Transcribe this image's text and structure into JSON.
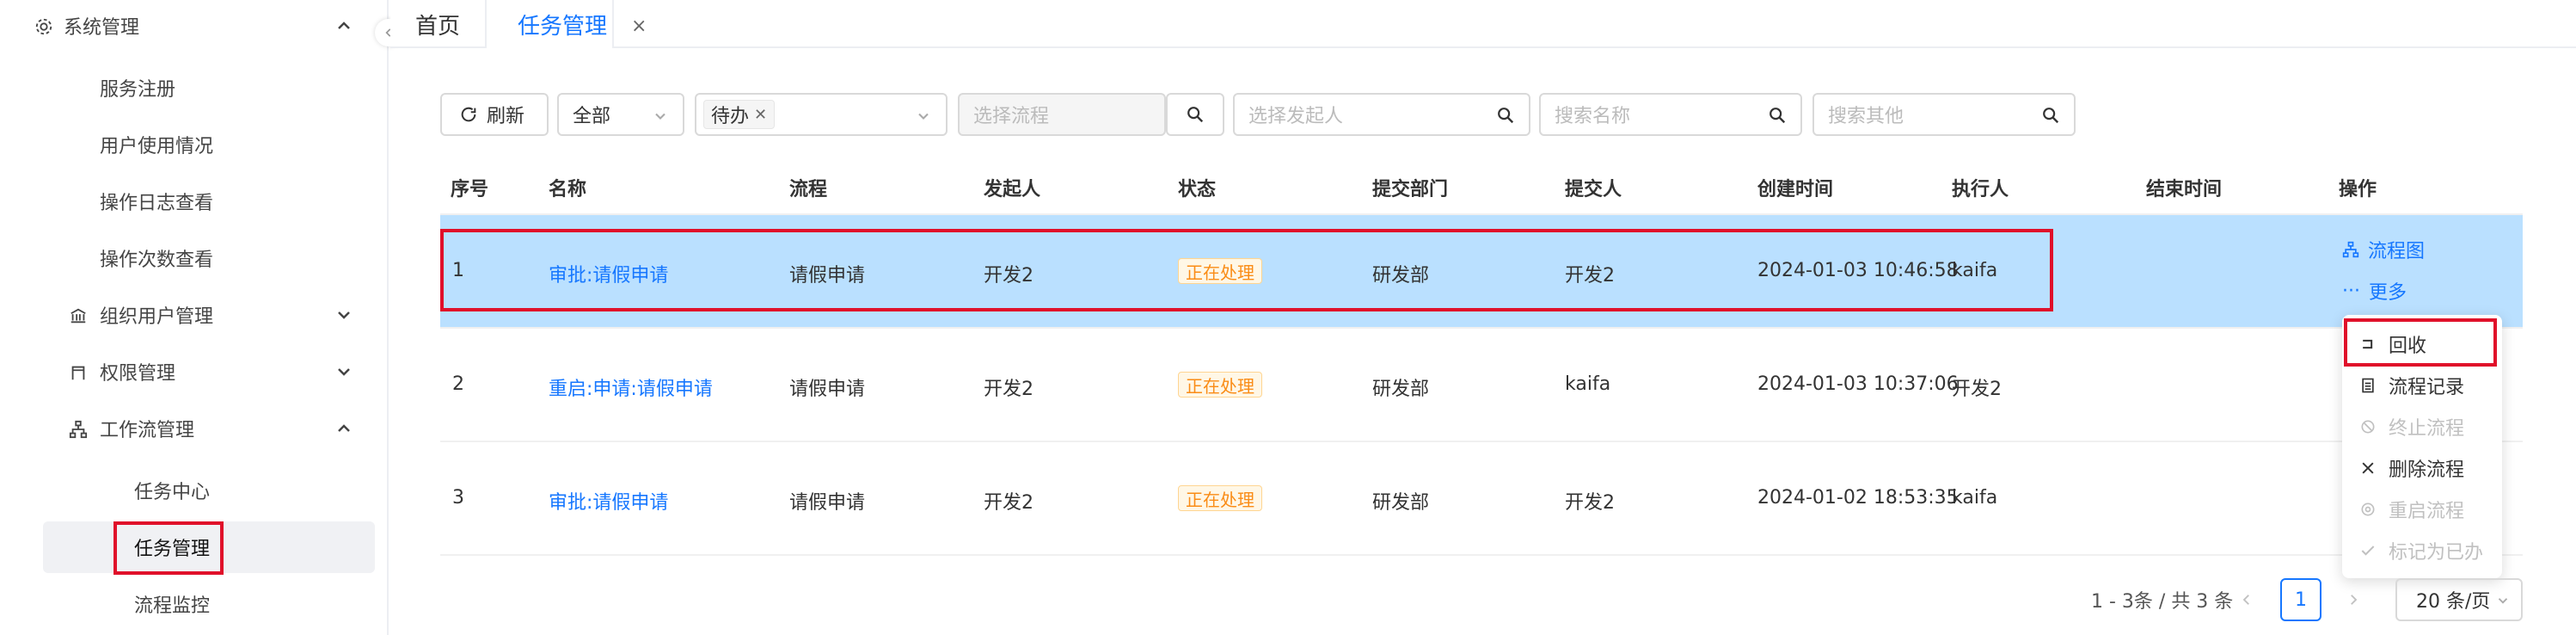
{
  "sidebar": {
    "items": [
      {
        "label": "系统管理",
        "icon": "gear-icon",
        "expanded": true
      },
      {
        "label": "服务注册"
      },
      {
        "label": "用户使用情况"
      },
      {
        "label": "操作日志查看"
      },
      {
        "label": "操作次数查看"
      },
      {
        "label": "组织用户管理",
        "icon": "bank-icon",
        "expanded": false
      },
      {
        "label": "权限管理",
        "icon": "gate-icon",
        "expanded": false
      },
      {
        "label": "工作流管理",
        "icon": "flow-icon",
        "expanded": true
      },
      {
        "label": "任务中心"
      },
      {
        "label": "任务管理",
        "active": true
      },
      {
        "label": "流程监控"
      }
    ]
  },
  "tabs": [
    {
      "label": "首页"
    },
    {
      "label": "任务管理",
      "active": true,
      "close": "×"
    }
  ],
  "toolbar": {
    "refresh_label": "刷新",
    "scope_value": "全部",
    "status_tag": "待办",
    "flow_placeholder": "选择流程",
    "initiator_placeholder": "选择发起人",
    "name_placeholder": "搜索名称",
    "other_placeholder": "搜索其他"
  },
  "table": {
    "headers": [
      "序号",
      "名称",
      "流程",
      "发起人",
      "状态",
      "提交部门",
      "提交人",
      "创建时间",
      "执行人",
      "结束时间",
      "操作"
    ],
    "rows": [
      {
        "index": "1",
        "name": "审批:请假申请",
        "flow": "请假申请",
        "initiator": "开发2",
        "status": "正在处理",
        "dept": "研发部",
        "submitter": "开发2",
        "created": "2024-01-03 10:46:58",
        "executor": "kaifa",
        "ended": ""
      },
      {
        "index": "2",
        "name": "重启:申请:请假申请",
        "flow": "请假申请",
        "initiator": "开发2",
        "status": "正在处理",
        "dept": "研发部",
        "submitter": "kaifa",
        "created": "2024-01-03 10:37:06",
        "executor": "开发2",
        "ended": ""
      },
      {
        "index": "3",
        "name": "审批:请假申请",
        "flow": "请假申请",
        "initiator": "开发2",
        "status": "正在处理",
        "dept": "研发部",
        "submitter": "开发2",
        "created": "2024-01-02 18:53:35",
        "executor": "kaifa",
        "ended": ""
      }
    ],
    "actions": {
      "flowchart": "流程图",
      "more": "更多"
    }
  },
  "menu": {
    "items": [
      {
        "label": "回收",
        "icon": "recall-icon",
        "disabled": false
      },
      {
        "label": "流程记录",
        "icon": "record-icon",
        "disabled": false
      },
      {
        "label": "终止流程",
        "icon": "stop-icon",
        "disabled": true
      },
      {
        "label": "删除流程",
        "icon": "close-icon",
        "disabled": false
      },
      {
        "label": "重启流程",
        "icon": "restart-icon",
        "disabled": true
      },
      {
        "label": "标记为已办",
        "icon": "check-icon",
        "disabled": true
      }
    ]
  },
  "pagination": {
    "summary": "1 - 3条 / 共 3 条",
    "current_page": "1",
    "page_size": "20 条/页"
  },
  "colors": {
    "accent": "#1677ff",
    "highlight_row": "#bae0ff",
    "annotation": "#e0102a"
  }
}
